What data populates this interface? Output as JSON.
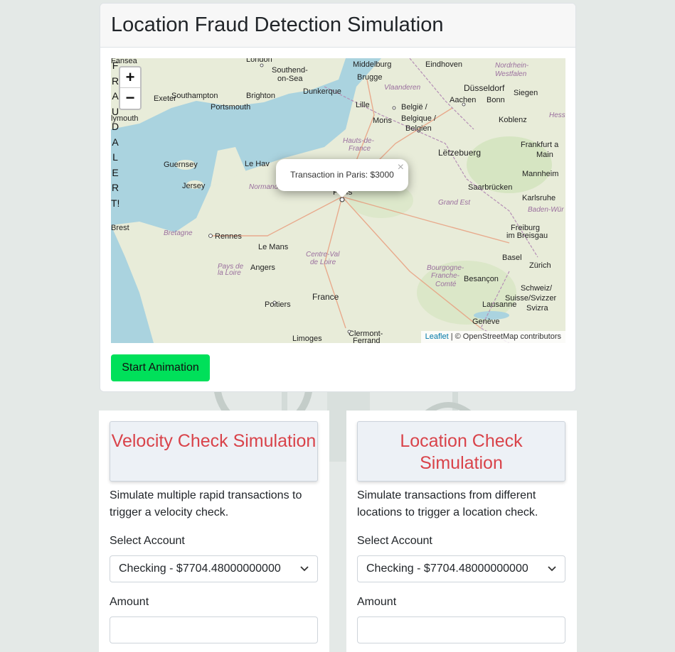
{
  "page": {
    "title": "Location Fraud Detection Simulation"
  },
  "map": {
    "fraud_alert": "FRAUD ALERT!",
    "zoom_in_label": "+",
    "zoom_out_label": "−",
    "popup_text": "Transaction in Paris: $3000",
    "popup_close": "×",
    "attribution_link": "Leaflet",
    "attribution_text": "| © OpenStreetMap contributors",
    "places": [
      "London",
      "Brighton",
      "Southampton",
      "Portsmouth",
      "Exeter",
      "Plymouth",
      "Guernsey",
      "Jersey",
      "Brest",
      "Rennes",
      "Le Mans",
      "Angers",
      "Poitiers",
      "Limoges",
      "Clermont-Ferrand",
      "Middelburg",
      "Brugge",
      "Eindhoven",
      "Düsseldorf",
      "Aachen",
      "Bonn",
      "Siegen",
      "Koblenz",
      "Lille",
      "Mons",
      "Dunkerque",
      "België / Belgique / Belgien",
      "Lëtzebuerg",
      "Frankfurt am Main",
      "Mannheim",
      "Saarbrücken",
      "Karlsruhe",
      "Freiburg im Breisgau",
      "Basel",
      "Zürich",
      "Besançon",
      "Lausanne",
      "Genève",
      "Schweiz/ Suisse/Svizzera",
      "France",
      "Paris",
      "Le Havre",
      "Southend-on-Sea",
      "Hauts-de-France",
      "Normandie",
      "Bretagne",
      "Pays de la Loire",
      "Centre-Val de Loire",
      "Grand Est",
      "Bourgogne-Franche-Comté",
      "Baden-Würt",
      "Nordrhein-Westfalen",
      "Vlaanderen",
      "Hesse"
    ]
  },
  "controls": {
    "start_button": "Start Animation"
  },
  "velocity": {
    "title": "Velocity Check Simulation",
    "description": "Simulate multiple rapid transactions to trigger a velocity check.",
    "account_label": "Select Account",
    "account_value": "Checking - $7704.48000000000",
    "amount_label": "Amount",
    "amount_value": ""
  },
  "location": {
    "title": "Location Check Simulation",
    "description": "Simulate transactions from different locations to trigger a location check.",
    "account_label": "Select Account",
    "account_value": "Checking - $7704.48000000000",
    "amount_label": "Amount",
    "amount_value": ""
  },
  "colors": {
    "start_button": "#00e05a",
    "panel_title": "#d9434a",
    "sea": "#aad3df",
    "land": "#e8ecd9"
  }
}
